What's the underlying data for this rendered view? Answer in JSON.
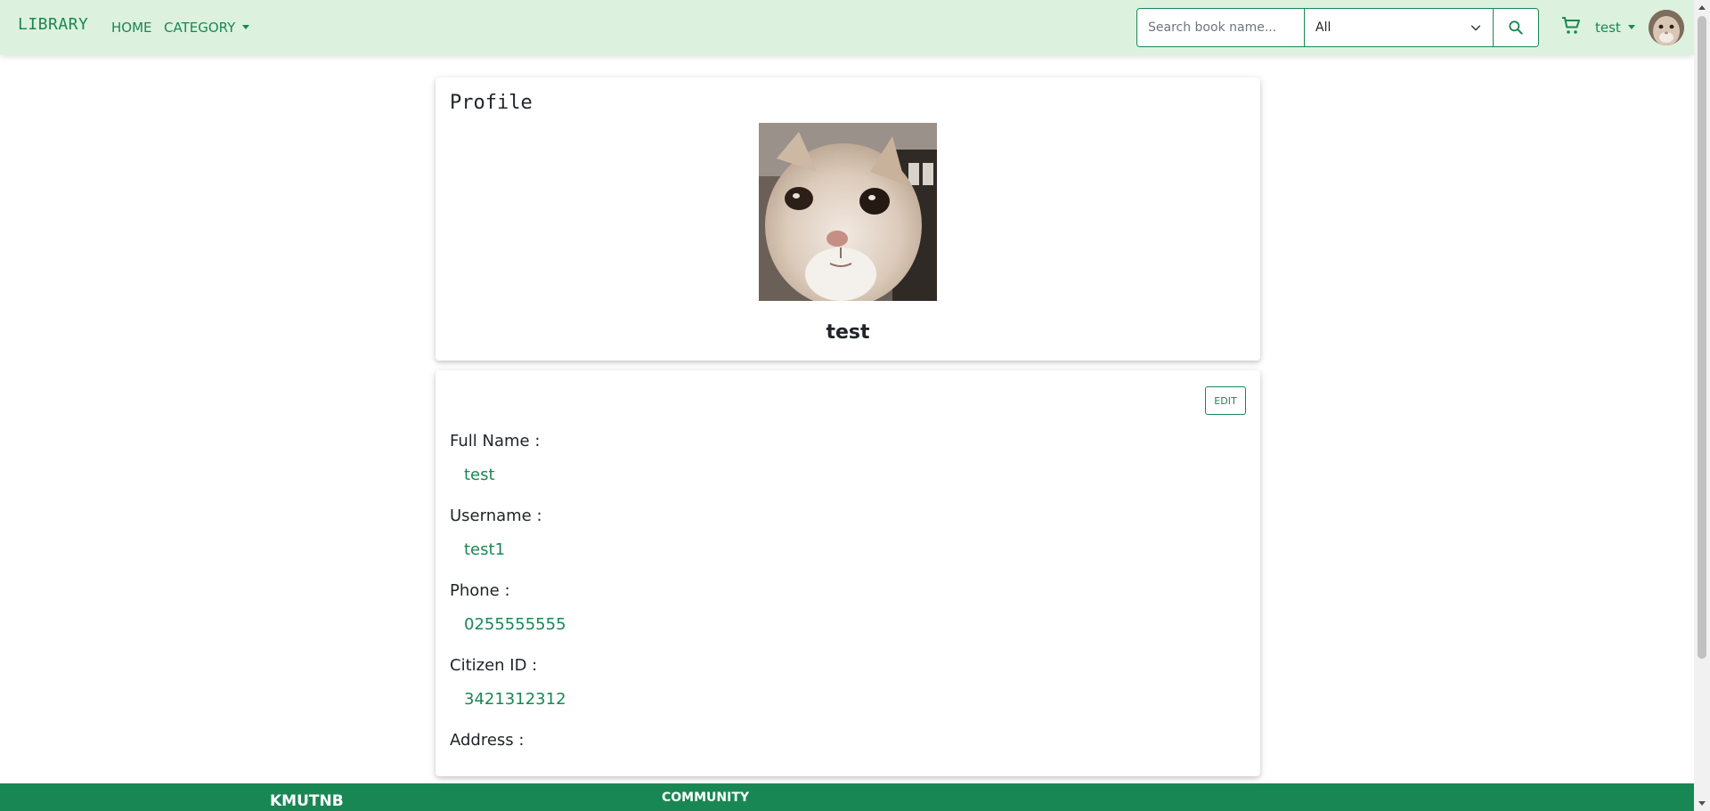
{
  "navbar": {
    "brand": "LIBRARY",
    "links": [
      {
        "label": "HOME"
      },
      {
        "label": "CATEGORY"
      }
    ],
    "search": {
      "placeholder": "Search book name...",
      "value": "",
      "category_selected": "All"
    },
    "user_label": "test"
  },
  "profile": {
    "title": "Profile",
    "name": "test"
  },
  "details": {
    "edit_label": "EDIT",
    "fields": [
      {
        "label": "Full Name :",
        "value": "test"
      },
      {
        "label": "Username :",
        "value": "test1"
      },
      {
        "label": "Phone :",
        "value": "0255555555"
      },
      {
        "label": "Citizen ID :",
        "value": "3421312312"
      },
      {
        "label": "Address :",
        "value": ""
      }
    ]
  },
  "footer": {
    "brand": "KMUTNB",
    "community_heading": "COMMUNITY"
  },
  "colors": {
    "accent": "#198754",
    "navbar_bg": "#ddf2de"
  }
}
